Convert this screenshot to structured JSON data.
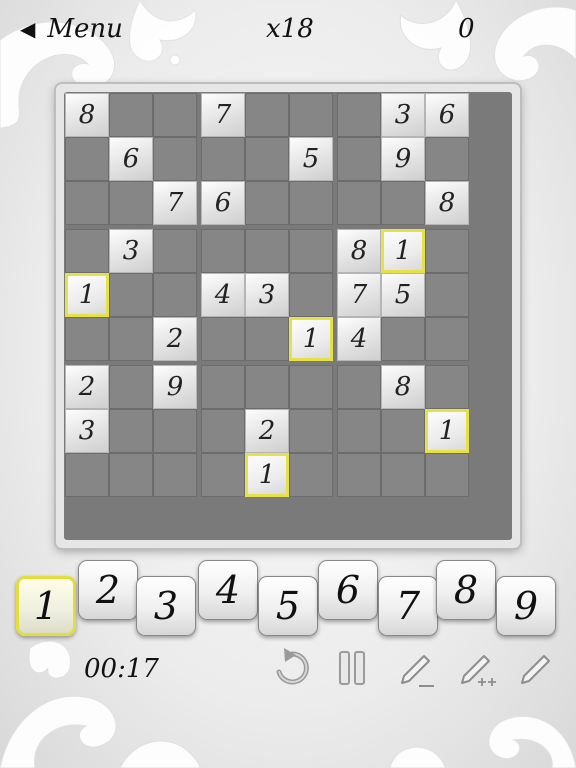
{
  "header": {
    "menu_label": "Menu",
    "multiplier": "x18",
    "score": "0"
  },
  "board": {
    "cells": [
      [
        8,
        0,
        0,
        7,
        0,
        0,
        0,
        3,
        6
      ],
      [
        0,
        6,
        0,
        0,
        0,
        5,
        0,
        9,
        0
      ],
      [
        0,
        0,
        7,
        6,
        0,
        0,
        0,
        0,
        8
      ],
      [
        0,
        3,
        0,
        0,
        0,
        0,
        8,
        1,
        0
      ],
      [
        1,
        0,
        0,
        4,
        3,
        0,
        7,
        5,
        0
      ],
      [
        0,
        0,
        2,
        0,
        0,
        1,
        4,
        0,
        0
      ],
      [
        2,
        0,
        9,
        0,
        0,
        0,
        0,
        8,
        0
      ],
      [
        3,
        0,
        0,
        0,
        2,
        0,
        0,
        0,
        1
      ],
      [
        0,
        0,
        0,
        0,
        1,
        0,
        0,
        0,
        0
      ]
    ],
    "highlight_digit": 1
  },
  "keypad": {
    "digits": [
      "1",
      "2",
      "3",
      "4",
      "5",
      "6",
      "7",
      "8",
      "9"
    ],
    "selected": "1"
  },
  "footer": {
    "timer": "00:17"
  },
  "tools": [
    "undo-icon",
    "pause-icon",
    "pencil-erase-icon",
    "pencil-notes-icon",
    "pencil-icon"
  ],
  "colors": {
    "highlight": "#e6e04a",
    "empty_cell": "#868686",
    "board_bg": "#e6e6e6"
  }
}
